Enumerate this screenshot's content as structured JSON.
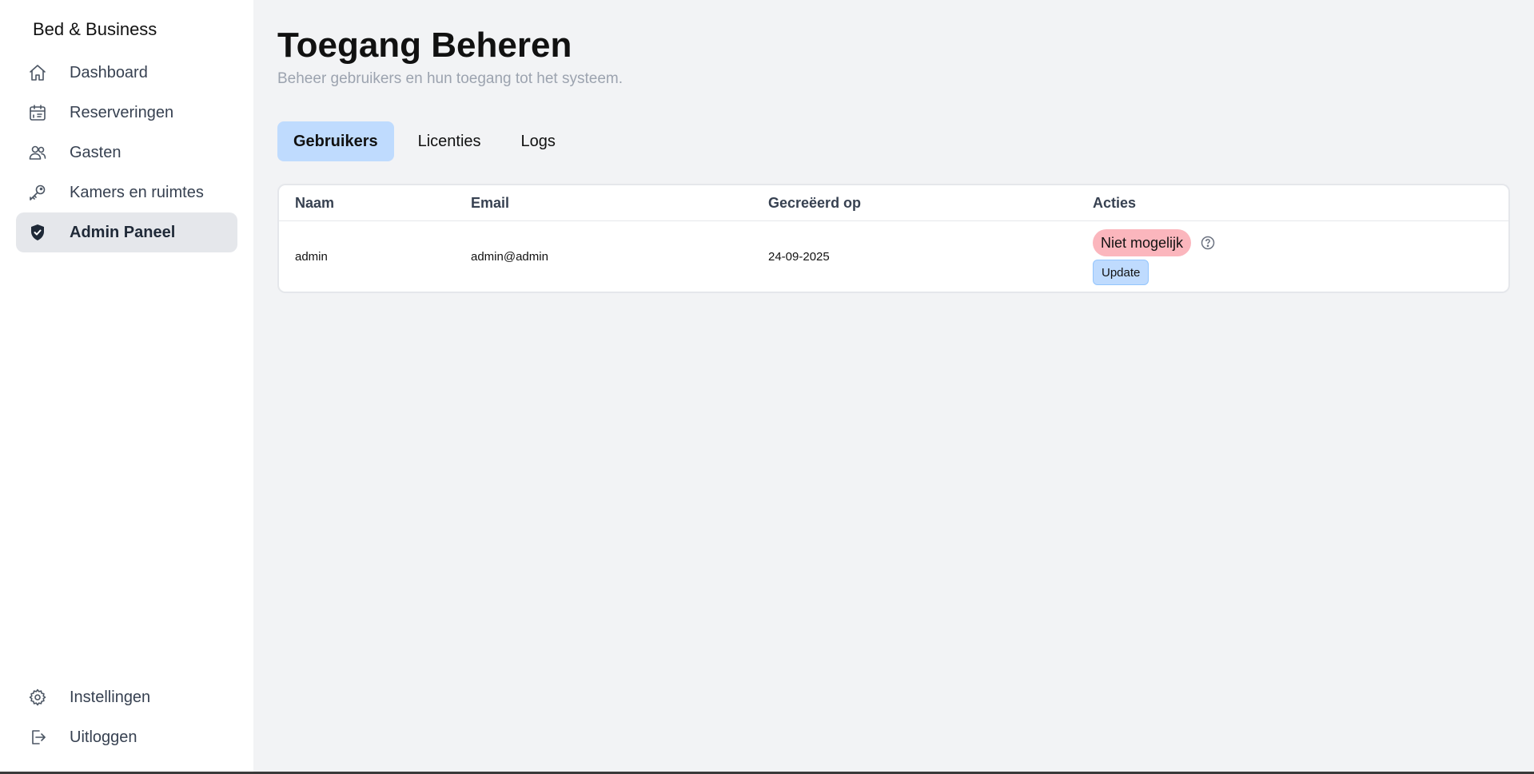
{
  "sidebar": {
    "brand": "Bed & Business",
    "items": [
      {
        "label": "Dashboard",
        "icon": "home-icon"
      },
      {
        "label": "Reserveringen",
        "icon": "calendar-icon"
      },
      {
        "label": "Gasten",
        "icon": "users-icon"
      },
      {
        "label": "Kamers en ruimtes",
        "icon": "key-icon"
      },
      {
        "label": "Admin Paneel",
        "icon": "shield-check-icon",
        "active": true
      }
    ],
    "bottom_items": [
      {
        "label": "Instellingen",
        "icon": "gear-icon"
      },
      {
        "label": "Uitloggen",
        "icon": "logout-icon"
      }
    ]
  },
  "main": {
    "title": "Toegang Beheren",
    "subtitle": "Beheer gebruikers en hun toegang tot het systeem.",
    "tabs": [
      {
        "label": "Gebruikers",
        "active": true
      },
      {
        "label": "Licenties",
        "active": false
      },
      {
        "label": "Logs",
        "active": false
      }
    ],
    "table": {
      "headers": [
        "Naam",
        "Email",
        "Gecreëerd op",
        "Acties"
      ],
      "rows": [
        {
          "naam": "admin",
          "email": "admin@admin",
          "created": "24-09-2025",
          "status_badge": "Niet mogelijk",
          "action_button": "Update"
        }
      ]
    }
  },
  "colors": {
    "active_tab": "#bfdbfe",
    "danger_badge": "#fbb6bd",
    "sidebar_active": "#e5e7eb"
  }
}
